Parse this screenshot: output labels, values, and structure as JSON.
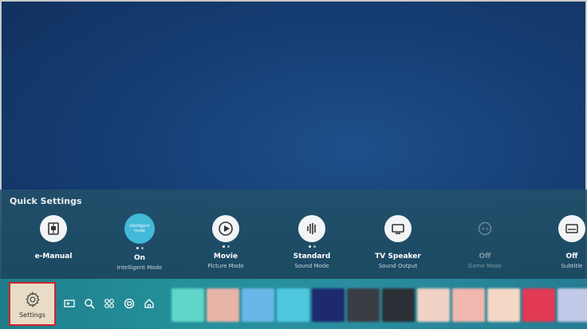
{
  "quick_settings": {
    "title": "Quick Settings",
    "items": [
      {
        "value": "e-Manual",
        "label": "",
        "icon": "book-icon"
      },
      {
        "value": "On",
        "label": "Intelligent Mode",
        "icon": "intelligent-mode-icon",
        "active_text": "Intelligent mode"
      },
      {
        "value": "Movie",
        "label": "Picture Mode",
        "icon": "play-icon"
      },
      {
        "value": "Standard",
        "label": "Sound Mode",
        "icon": "sound-wave-icon"
      },
      {
        "value": "TV Speaker",
        "label": "Sound Output",
        "icon": "tv-icon"
      },
      {
        "value": "Off",
        "label": "Game Mode",
        "icon": "gamepad-icon"
      },
      {
        "value": "Off",
        "label": "Subtitle",
        "icon": "subtitle-icon"
      }
    ]
  },
  "bottom_bar": {
    "settings_label": "Settings",
    "nav_icons": [
      "source-icon",
      "search-icon",
      "apps-grid-icon",
      "ambient-icon",
      "home-icon"
    ],
    "app_colors": [
      "#5fd6c8",
      "#e7b4a8",
      "#6bb6e8",
      "#4fc7de",
      "#1d2a6e",
      "#3a3d44",
      "#2c3036",
      "#f1d2c6",
      "#f2b7ae",
      "#f4d8c6",
      "#e23a54",
      "#c3c9e8"
    ]
  },
  "colors": {
    "accent": "#43b9d8",
    "highlight_border": "#d4232c",
    "background": "#163e74"
  }
}
